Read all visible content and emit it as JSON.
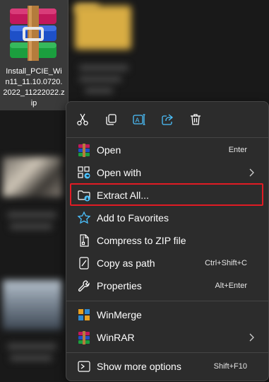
{
  "file": {
    "name": "Install_PCIE_Win11_11.10.0720.2022_11222022.zip",
    "line1": "Install_PCIE_Wi",
    "line2": "n11_11.10.0720.",
    "line3": "2022_11222022.z",
    "line4": "ip",
    "icon": "winrar-archive-icon"
  },
  "quick_actions": [
    {
      "name": "cut",
      "icon": "scissors-icon"
    },
    {
      "name": "copy",
      "icon": "copy-icon"
    },
    {
      "name": "rename",
      "icon": "rename-icon"
    },
    {
      "name": "share",
      "icon": "share-icon"
    },
    {
      "name": "delete",
      "icon": "trash-icon"
    }
  ],
  "menu": {
    "items": [
      {
        "label": "Open",
        "shortcut": "Enter",
        "icon": "winrar-icon"
      },
      {
        "label": "Open with",
        "shortcut": "",
        "icon": "open-with-icon",
        "submenu": true
      },
      {
        "label": "Extract All...",
        "shortcut": "",
        "icon": "extract-folder-icon",
        "highlighted": true
      },
      {
        "label": "Add to Favorites",
        "shortcut": "",
        "icon": "star-icon"
      },
      {
        "label": "Compress to ZIP file",
        "shortcut": "",
        "icon": "zip-icon"
      },
      {
        "label": "Copy as path",
        "shortcut": "Ctrl+Shift+C",
        "icon": "copy-path-icon"
      },
      {
        "label": "Properties",
        "shortcut": "Alt+Enter",
        "icon": "wrench-icon"
      },
      {
        "label": "WinMerge",
        "shortcut": "",
        "icon": "winmerge-icon"
      },
      {
        "label": "WinRAR",
        "shortcut": "",
        "icon": "winrar-icon",
        "submenu": true
      },
      {
        "label": "Show more options",
        "shortcut": "Shift+F10",
        "icon": "show-more-icon"
      }
    ]
  },
  "colors": {
    "menu_bg": "#2c2c2c",
    "accent": "#4cc2ff",
    "highlight": "#e01b24",
    "selected_tile": "#3a3a3a"
  }
}
